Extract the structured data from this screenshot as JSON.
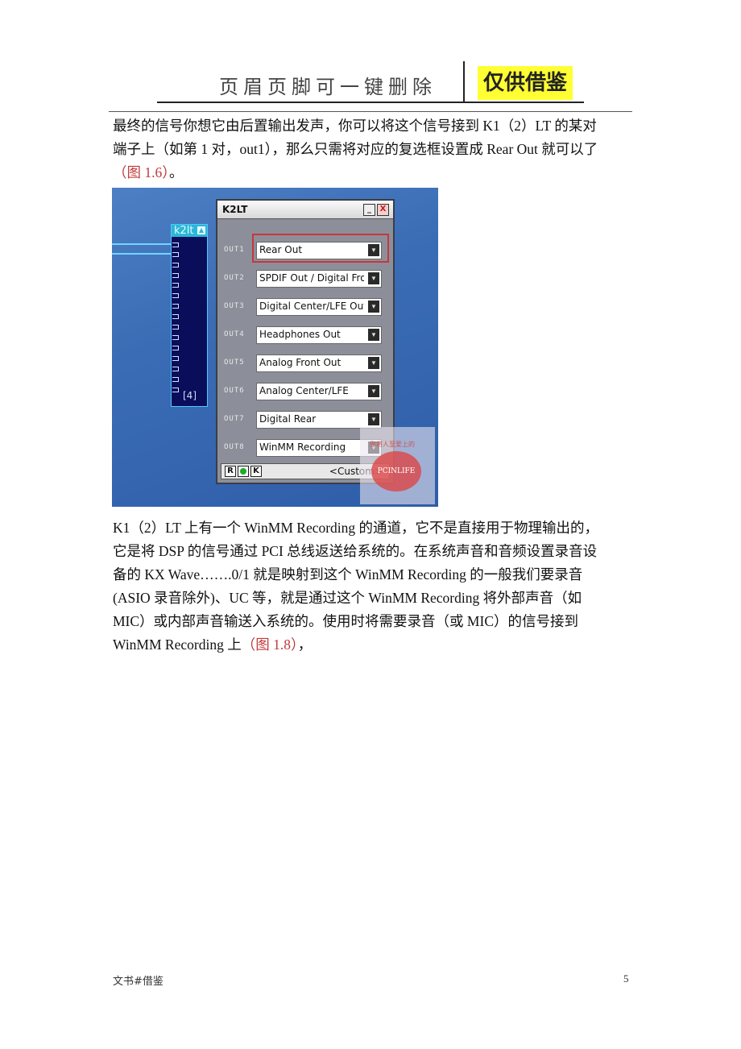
{
  "header": {
    "text": "页眉页脚可一键删除",
    "badge": "仅供借鉴"
  },
  "paragraph1": {
    "line1": "最终的信号你想它由后置输出发声，你可以将这个信号接到 K1（2）LT 的某对",
    "line2": "端子上（如第 1 对，out1），那么只需将对应的复选框设置成 Rear Out 就可以了",
    "ref": "（图 1.6）",
    "end": "。"
  },
  "figure": {
    "node_title": "k2lt",
    "node_label": "[4]",
    "window_title": "K2LT",
    "minimize_label": "_",
    "close_label": "X",
    "outputs": [
      {
        "label": "OUT1",
        "value": "Rear Out"
      },
      {
        "label": "OUT2",
        "value": "SPDIF Out / Digital Fro"
      },
      {
        "label": "OUT3",
        "value": "Digital Center/LFE Out"
      },
      {
        "label": "OUT4",
        "value": "Headphones Out"
      },
      {
        "label": "OUT5",
        "value": "Analog Front Out"
      },
      {
        "label": "OUT6",
        "value": "Analog Center/LFE"
      },
      {
        "label": "OUT7",
        "value": "Digital Rear"
      },
      {
        "label": "OUT8",
        "value": "WinMM Recording"
      }
    ],
    "footer_buttons": [
      "R",
      "",
      "K"
    ],
    "preset": "<Custom>",
    "watermark_text": "您将人至爱上的",
    "watermark_logo": "PCINLIFE",
    "highlight_color": "#c8363b"
  },
  "paragraph2": {
    "lines": [
      "K1（2）LT 上有一个 WinMM Recording 的通道，它不是直接用于物理输出的，",
      "它是将 DSP 的信号通过 PCI 总线返送给系统的。在系统声音和音频设置录音设",
      "备的 KX Wave…….0/1 就是映射到这个 WinMM Recording 的一般我们要录音",
      "(ASIO 录音除外)、UC 等，就是通过这个 WinMM Recording 将外部声音（如",
      "MIC）或内部声音输送入系统的。使用时将需要录音（或 MIC）的信号接到"
    ],
    "last_line": "WinMM Recording 上",
    "ref": "（图 1.8）",
    "end": "，"
  },
  "footer": {
    "left": "文书#借鉴",
    "page": "5"
  }
}
